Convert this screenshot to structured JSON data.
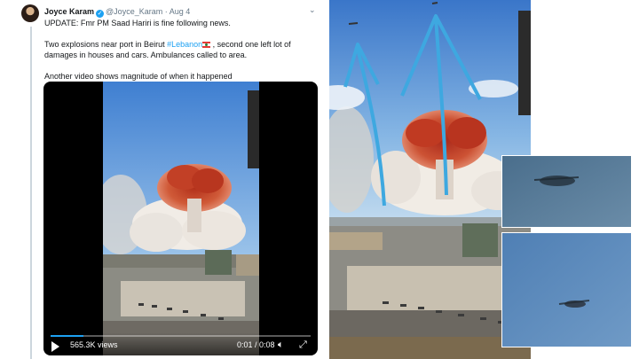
{
  "tweet": {
    "author_name": "Joyce Karam",
    "handle": "@Joyce_Karam",
    "separator": "·",
    "date": "Aug 4",
    "lines": {
      "update": "UPDATE: Fmr PM Saad Hariri is fine following news.",
      "p2_start": "Two explosions near port in Beirut ",
      "hashtag": "#Lebanon",
      "p2_end": " , second one left lot of damages in houses and cars. Ambulances called to area.",
      "p3": "Another video shows magnitude of when it happened"
    }
  },
  "video": {
    "views": "565.3K views",
    "time": "0:01 / 0:08",
    "progress": 0.125
  },
  "icons": [
    "verified-icon",
    "more-chevron-icon",
    "play-icon",
    "volume-icon",
    "fullscreen-icon",
    "lebanon-flag-icon"
  ],
  "colors": {
    "link": "#1da1f2",
    "annotation_arrow": "#3ea8e0",
    "smoke": "#c8462a"
  }
}
